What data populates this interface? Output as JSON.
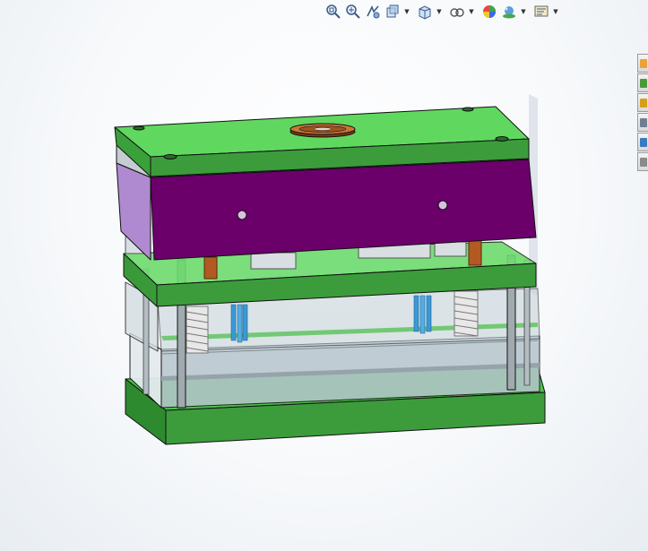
{
  "heads_up_toolbar": {
    "buttons": [
      {
        "icon": "zoom-to-fit-icon",
        "has_dropdown": false
      },
      {
        "icon": "zoom-to-area-icon",
        "has_dropdown": false
      },
      {
        "icon": "previous-view-icon",
        "has_dropdown": false
      },
      {
        "icon": "section-view-icon",
        "has_dropdown": true
      },
      {
        "icon": "view-orientation-icon",
        "has_dropdown": true
      },
      {
        "icon": "display-style-icon",
        "has_dropdown": true
      },
      {
        "icon": "edit-appearance-icon",
        "has_dropdown": false
      },
      {
        "icon": "apply-scene-icon",
        "has_dropdown": true
      },
      {
        "icon": "view-settings-icon",
        "has_dropdown": true
      }
    ]
  },
  "task_pane": {
    "tabs": [
      {
        "icon": "solidworks-resources-icon",
        "color": "#e8a33a"
      },
      {
        "icon": "design-library-icon",
        "color": "#4a9a3a"
      },
      {
        "icon": "file-explorer-icon",
        "color": "#d4a017"
      },
      {
        "icon": "view-palette-icon",
        "color": "#6f7f8f"
      },
      {
        "icon": "appearances-scenes-icon",
        "color": "#3a7ac0"
      },
      {
        "icon": "custom-properties-icon",
        "color": "#8a8a8a"
      }
    ]
  },
  "model": {
    "description_colors": {
      "clamp_plate": "#5dd55d",
      "cavity_plate": "#6b006b",
      "support_plate": "#2f8a2f",
      "spacer": "#b9c6cf",
      "guide_pin": "#9aa4aa",
      "sprue_bushing": "#a0522d",
      "ejector_pin": "#3a9ad6"
    }
  }
}
